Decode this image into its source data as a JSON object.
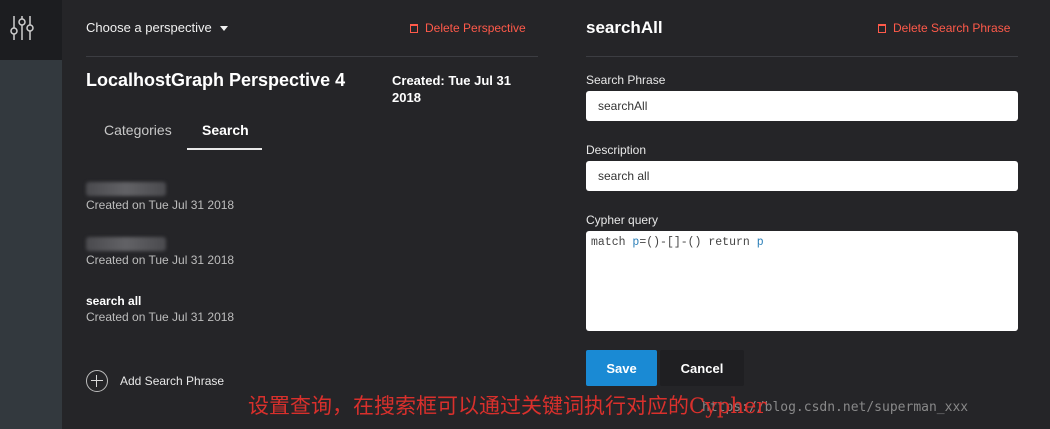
{
  "left": {
    "perspective_select": "Choose a perspective",
    "delete_perspective": "Delete Perspective",
    "perspective_title": "LocalhostGraph Perspective 4",
    "created": "Created: Tue Jul 31 2018",
    "tabs": [
      "Categories",
      "Search"
    ],
    "active_tab": "Search",
    "items": [
      {
        "title": "",
        "date": "Created on Tue Jul 31 2018"
      },
      {
        "title": "",
        "date": "Created on Tue Jul 31 2018"
      },
      {
        "title": "search all",
        "date": "Created on Tue Jul 31 2018"
      }
    ],
    "add_label": "Add Search Phrase"
  },
  "right": {
    "title": "searchAll",
    "delete_label": "Delete Search Phrase",
    "search_phrase_label": "Search Phrase",
    "search_phrase_value": "searchAll",
    "description_label": "Description",
    "description_value": "search all",
    "cypher_label": "Cypher query",
    "cypher": {
      "match": "match",
      "p1": "p",
      "pattern": "=()-[]-()",
      "ret": "return",
      "p2": "p"
    },
    "save_label": "Save",
    "cancel_label": "Cancel"
  },
  "overlay": {
    "caption": "设置查询，在搜索框可以通过关键词执行对应的Cypher",
    "watermark": "https://blog.csdn.net/superman_xxx"
  },
  "colors": {
    "accent": "#1a8ad4",
    "danger": "#ff5a4a",
    "caption": "#d9302c"
  }
}
